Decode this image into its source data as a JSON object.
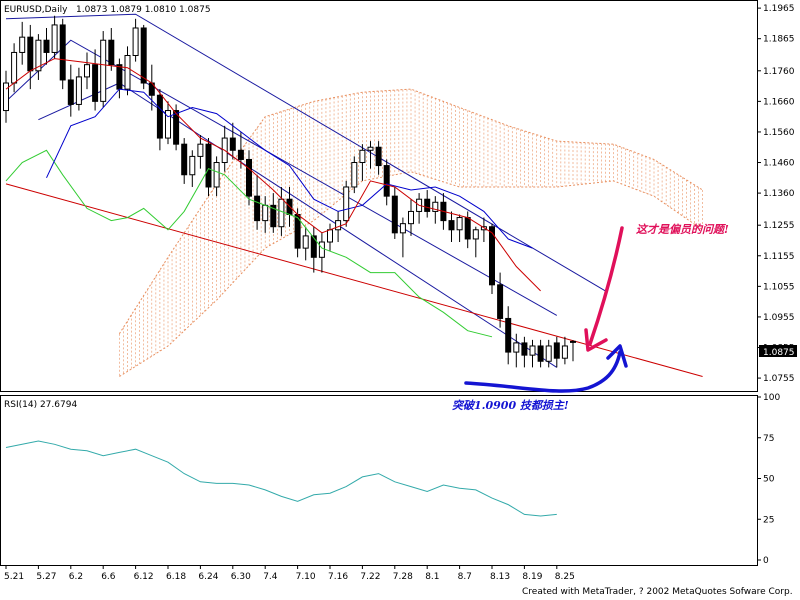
{
  "chart_data": {
    "type": "candlestick",
    "header": {
      "symbol": "EURUSD,Daily",
      "values": "1.0873 1.0879 1.0810 1.0875"
    },
    "current_price_label": "1.0875",
    "x_tick_labels": [
      {
        "label": "5.21",
        "bar": 0
      },
      {
        "label": "5.27",
        "bar": 4
      },
      {
        "label": "6.2",
        "bar": 8
      },
      {
        "label": "6.6",
        "bar": 12
      },
      {
        "label": "6.12",
        "bar": 16
      },
      {
        "label": "6.18",
        "bar": 20
      },
      {
        "label": "6.24",
        "bar": 24
      },
      {
        "label": "6.30",
        "bar": 28
      },
      {
        "label": "7.4",
        "bar": 32
      },
      {
        "label": "7.10",
        "bar": 36
      },
      {
        "label": "7.16",
        "bar": 40
      },
      {
        "label": "7.22",
        "bar": 44
      },
      {
        "label": "7.28",
        "bar": 48
      },
      {
        "label": "8.1",
        "bar": 52
      },
      {
        "label": "8.7",
        "bar": 56
      },
      {
        "label": "8.13",
        "bar": 60
      },
      {
        "label": "8.19",
        "bar": 64
      },
      {
        "label": "8.25",
        "bar": 68
      }
    ],
    "price_axis": {
      "ylim": [
        1.0716,
        1.1985
      ],
      "ticks": [
        "1.1965",
        "1.1865",
        "1.1760",
        "1.1660",
        "1.1560",
        "1.1460",
        "1.1360",
        "1.1255",
        "1.1155",
        "1.1055",
        "1.0955",
        "1.0855",
        "1.0755"
      ]
    },
    "ohlc": [
      [
        1.163,
        1.176,
        1.159,
        1.172
      ],
      [
        1.172,
        1.185,
        1.169,
        1.182
      ],
      [
        1.182,
        1.192,
        1.178,
        1.187
      ],
      [
        1.187,
        1.191,
        1.17,
        1.176
      ],
      [
        1.176,
        1.188,
        1.173,
        1.186
      ],
      [
        1.186,
        1.19,
        1.178,
        1.182
      ],
      [
        1.182,
        1.194,
        1.18,
        1.191
      ],
      [
        1.191,
        1.193,
        1.17,
        1.173
      ],
      [
        1.173,
        1.178,
        1.161,
        1.165
      ],
      [
        1.165,
        1.177,
        1.163,
        1.174
      ],
      [
        1.174,
        1.182,
        1.17,
        1.178
      ],
      [
        1.178,
        1.183,
        1.163,
        1.166
      ],
      [
        1.166,
        1.189,
        1.164,
        1.186
      ],
      [
        1.186,
        1.19,
        1.176,
        1.178
      ],
      [
        1.178,
        1.18,
        1.167,
        1.17
      ],
      [
        1.17,
        1.184,
        1.168,
        1.181
      ],
      [
        1.181,
        1.193,
        1.179,
        1.19
      ],
      [
        1.19,
        1.191,
        1.17,
        1.172
      ],
      [
        1.172,
        1.178,
        1.163,
        1.168
      ],
      [
        1.168,
        1.17,
        1.15,
        1.154
      ],
      [
        1.154,
        1.166,
        1.152,
        1.163
      ],
      [
        1.163,
        1.165,
        1.15,
        1.152
      ],
      [
        1.152,
        1.154,
        1.139,
        1.142
      ],
      [
        1.142,
        1.15,
        1.138,
        1.148
      ],
      [
        1.148,
        1.155,
        1.144,
        1.152
      ],
      [
        1.152,
        1.154,
        1.135,
        1.138
      ],
      [
        1.138,
        1.148,
        1.135,
        1.146
      ],
      [
        1.146,
        1.158,
        1.143,
        1.154
      ],
      [
        1.154,
        1.159,
        1.147,
        1.15
      ],
      [
        1.15,
        1.156,
        1.144,
        1.147
      ],
      [
        1.147,
        1.15,
        1.132,
        1.135
      ],
      [
        1.135,
        1.142,
        1.124,
        1.127
      ],
      [
        1.127,
        1.135,
        1.123,
        1.132
      ],
      [
        1.132,
        1.136,
        1.123,
        1.125
      ],
      [
        1.125,
        1.138,
        1.122,
        1.134
      ],
      [
        1.134,
        1.138,
        1.125,
        1.129
      ],
      [
        1.129,
        1.131,
        1.115,
        1.118
      ],
      [
        1.118,
        1.125,
        1.114,
        1.122
      ],
      [
        1.122,
        1.125,
        1.11,
        1.115
      ],
      [
        1.115,
        1.123,
        1.11,
        1.12
      ],
      [
        1.12,
        1.126,
        1.117,
        1.124
      ],
      [
        1.124,
        1.13,
        1.12,
        1.127
      ],
      [
        1.127,
        1.14,
        1.125,
        1.138
      ],
      [
        1.138,
        1.148,
        1.136,
        1.146
      ],
      [
        1.146,
        1.152,
        1.14,
        1.15
      ],
      [
        1.15,
        1.153,
        1.144,
        1.151
      ],
      [
        1.151,
        1.153,
        1.142,
        1.145
      ],
      [
        1.145,
        1.147,
        1.132,
        1.135
      ],
      [
        1.135,
        1.138,
        1.121,
        1.123
      ],
      [
        1.123,
        1.128,
        1.115,
        1.126
      ],
      [
        1.126,
        1.134,
        1.122,
        1.13
      ],
      [
        1.13,
        1.136,
        1.126,
        1.134
      ],
      [
        1.134,
        1.137,
        1.128,
        1.13
      ],
      [
        1.13,
        1.135,
        1.126,
        1.133
      ],
      [
        1.133,
        1.136,
        1.124,
        1.127
      ],
      [
        1.127,
        1.13,
        1.12,
        1.124
      ],
      [
        1.124,
        1.129,
        1.12,
        1.128
      ],
      [
        1.128,
        1.13,
        1.118,
        1.121
      ],
      [
        1.121,
        1.125,
        1.115,
        1.124
      ],
      [
        1.124,
        1.128,
        1.12,
        1.125
      ],
      [
        1.125,
        1.126,
        1.103,
        1.106
      ],
      [
        1.106,
        1.11,
        1.092,
        1.095
      ],
      [
        1.095,
        1.099,
        1.08,
        1.084
      ],
      [
        1.084,
        1.09,
        1.079,
        1.087
      ],
      [
        1.087,
        1.089,
        1.079,
        1.083
      ],
      [
        1.083,
        1.088,
        1.079,
        1.086
      ],
      [
        1.086,
        1.088,
        1.079,
        1.081
      ],
      [
        1.081,
        1.088,
        1.079,
        1.086
      ],
      [
        1.087,
        1.089,
        1.079,
        1.082
      ],
      [
        1.082,
        1.089,
        1.08,
        1.086
      ],
      [
        1.0873,
        1.0879,
        1.081,
        1.0875
      ]
    ],
    "ma_fast": [
      [
        0,
        1.17
      ],
      [
        3,
        1.176
      ],
      [
        6,
        1.18
      ],
      [
        9,
        1.179
      ],
      [
        12,
        1.178
      ],
      [
        15,
        1.177
      ],
      [
        18,
        1.172
      ],
      [
        21,
        1.162
      ],
      [
        24,
        1.154
      ],
      [
        27,
        1.15
      ],
      [
        30,
        1.144
      ],
      [
        33,
        1.137
      ],
      [
        36,
        1.129
      ],
      [
        39,
        1.123
      ],
      [
        42,
        1.126
      ],
      [
        45,
        1.14
      ],
      [
        48,
        1.138
      ],
      [
        51,
        1.132
      ],
      [
        54,
        1.13
      ],
      [
        57,
        1.128
      ],
      [
        60,
        1.123
      ],
      [
        63,
        1.112
      ],
      [
        66,
        1.104
      ]
    ],
    "ma_slow": [
      [
        5,
        1.141
      ],
      [
        8,
        1.158
      ],
      [
        11,
        1.161
      ],
      [
        14,
        1.17
      ],
      [
        17,
        1.169
      ],
      [
        20,
        1.161
      ],
      [
        23,
        1.164
      ],
      [
        26,
        1.162
      ],
      [
        29,
        1.156
      ],
      [
        32,
        1.15
      ],
      [
        35,
        1.145
      ],
      [
        38,
        1.134
      ],
      [
        41,
        1.13
      ],
      [
        44,
        1.132
      ],
      [
        47,
        1.139
      ],
      [
        50,
        1.137
      ],
      [
        53,
        1.138
      ],
      [
        56,
        1.135
      ],
      [
        59,
        1.13
      ],
      [
        62,
        1.121
      ],
      [
        65,
        1.118
      ]
    ],
    "lagging_line": [
      [
        0,
        1.14
      ],
      [
        2,
        1.146
      ],
      [
        5,
        1.15
      ],
      [
        7,
        1.142
      ],
      [
        10,
        1.131
      ],
      [
        13,
        1.127
      ],
      [
        15,
        1.128
      ],
      [
        17,
        1.131
      ],
      [
        20,
        1.124
      ],
      [
        22,
        1.13
      ],
      [
        25,
        1.144
      ],
      [
        27,
        1.142
      ],
      [
        30,
        1.134
      ],
      [
        33,
        1.131
      ],
      [
        36,
        1.128
      ],
      [
        39,
        1.118
      ],
      [
        42,
        1.115
      ],
      [
        45,
        1.11
      ],
      [
        48,
        1.11
      ],
      [
        51,
        1.102
      ],
      [
        54,
        1.097
      ],
      [
        57,
        1.091
      ],
      [
        60,
        1.089
      ]
    ],
    "cloud": {
      "upper": [
        [
          14,
          1.09
        ],
        [
          20,
          1.115
        ],
        [
          26,
          1.139
        ],
        [
          32,
          1.161
        ],
        [
          38,
          1.166
        ],
        [
          44,
          1.169
        ],
        [
          50,
          1.17
        ],
        [
          56,
          1.164
        ],
        [
          62,
          1.158
        ],
        [
          68,
          1.153
        ],
        [
          75,
          1.152
        ],
        [
          80,
          1.147
        ],
        [
          86,
          1.137
        ]
      ],
      "lower": [
        [
          14,
          1.076
        ],
        [
          20,
          1.086
        ],
        [
          26,
          1.101
        ],
        [
          32,
          1.118
        ],
        [
          38,
          1.127
        ],
        [
          44,
          1.14
        ],
        [
          50,
          1.143
        ],
        [
          56,
          1.138
        ],
        [
          62,
          1.138
        ],
        [
          68,
          1.138
        ],
        [
          75,
          1.14
        ],
        [
          80,
          1.135
        ],
        [
          86,
          1.124
        ]
      ]
    },
    "lines": {
      "channel_upper": [
        [
          0,
          1.193
        ],
        [
          16,
          1.1945
        ],
        [
          74,
          1.104
        ]
      ],
      "channel_mid": [
        [
          0,
          1.166
        ],
        [
          8,
          1.186
        ],
        [
          68,
          1.096
        ]
      ],
      "channel_lower": [
        [
          4,
          1.16
        ],
        [
          14,
          1.172
        ],
        [
          68,
          1.079
        ]
      ],
      "red_trend": [
        [
          0,
          1.139
        ],
        [
          86,
          1.076
        ]
      ]
    },
    "rsi": {
      "label": "RSI(14) 27.6794",
      "ylim": [
        0,
        100
      ],
      "ticks": [
        "100",
        "75",
        "50",
        "25",
        "0"
      ],
      "values": [
        [
          0,
          69
        ],
        [
          2,
          71
        ],
        [
          4,
          73
        ],
        [
          6,
          71
        ],
        [
          8,
          68
        ],
        [
          10,
          67
        ],
        [
          12,
          64
        ],
        [
          14,
          66
        ],
        [
          16,
          68
        ],
        [
          18,
          64
        ],
        [
          20,
          60
        ],
        [
          22,
          53
        ],
        [
          24,
          48
        ],
        [
          26,
          47
        ],
        [
          28,
          47
        ],
        [
          30,
          46
        ],
        [
          32,
          43
        ],
        [
          34,
          39
        ],
        [
          36,
          36
        ],
        [
          38,
          40
        ],
        [
          40,
          41
        ],
        [
          42,
          45
        ],
        [
          44,
          51
        ],
        [
          46,
          53
        ],
        [
          48,
          48
        ],
        [
          50,
          45
        ],
        [
          52,
          42
        ],
        [
          54,
          46
        ],
        [
          56,
          44
        ],
        [
          58,
          43
        ],
        [
          60,
          38
        ],
        [
          62,
          34
        ],
        [
          64,
          28
        ],
        [
          66,
          27
        ],
        [
          68,
          28
        ]
      ]
    },
    "annotations": {
      "pink_text": "这才是偏员的问题!",
      "blue_text": "突破1.0900 技都损主!",
      "footer": "Created with MetaTrader, ? 2002 MetaQuotes Sofware Corp."
    },
    "colors": {
      "bull": "#ffffff",
      "bear": "#000000",
      "ma_fast": "#cc0000",
      "ma_slow": "#0000cc",
      "lagging": "#33cc33",
      "cloud": "#e89060",
      "channel": "#1a1aa0",
      "trend": "#cc0000",
      "rsi": "#33aaaa",
      "anno_pink": "#e0105a",
      "anno_blue": "#1414d2"
    }
  }
}
